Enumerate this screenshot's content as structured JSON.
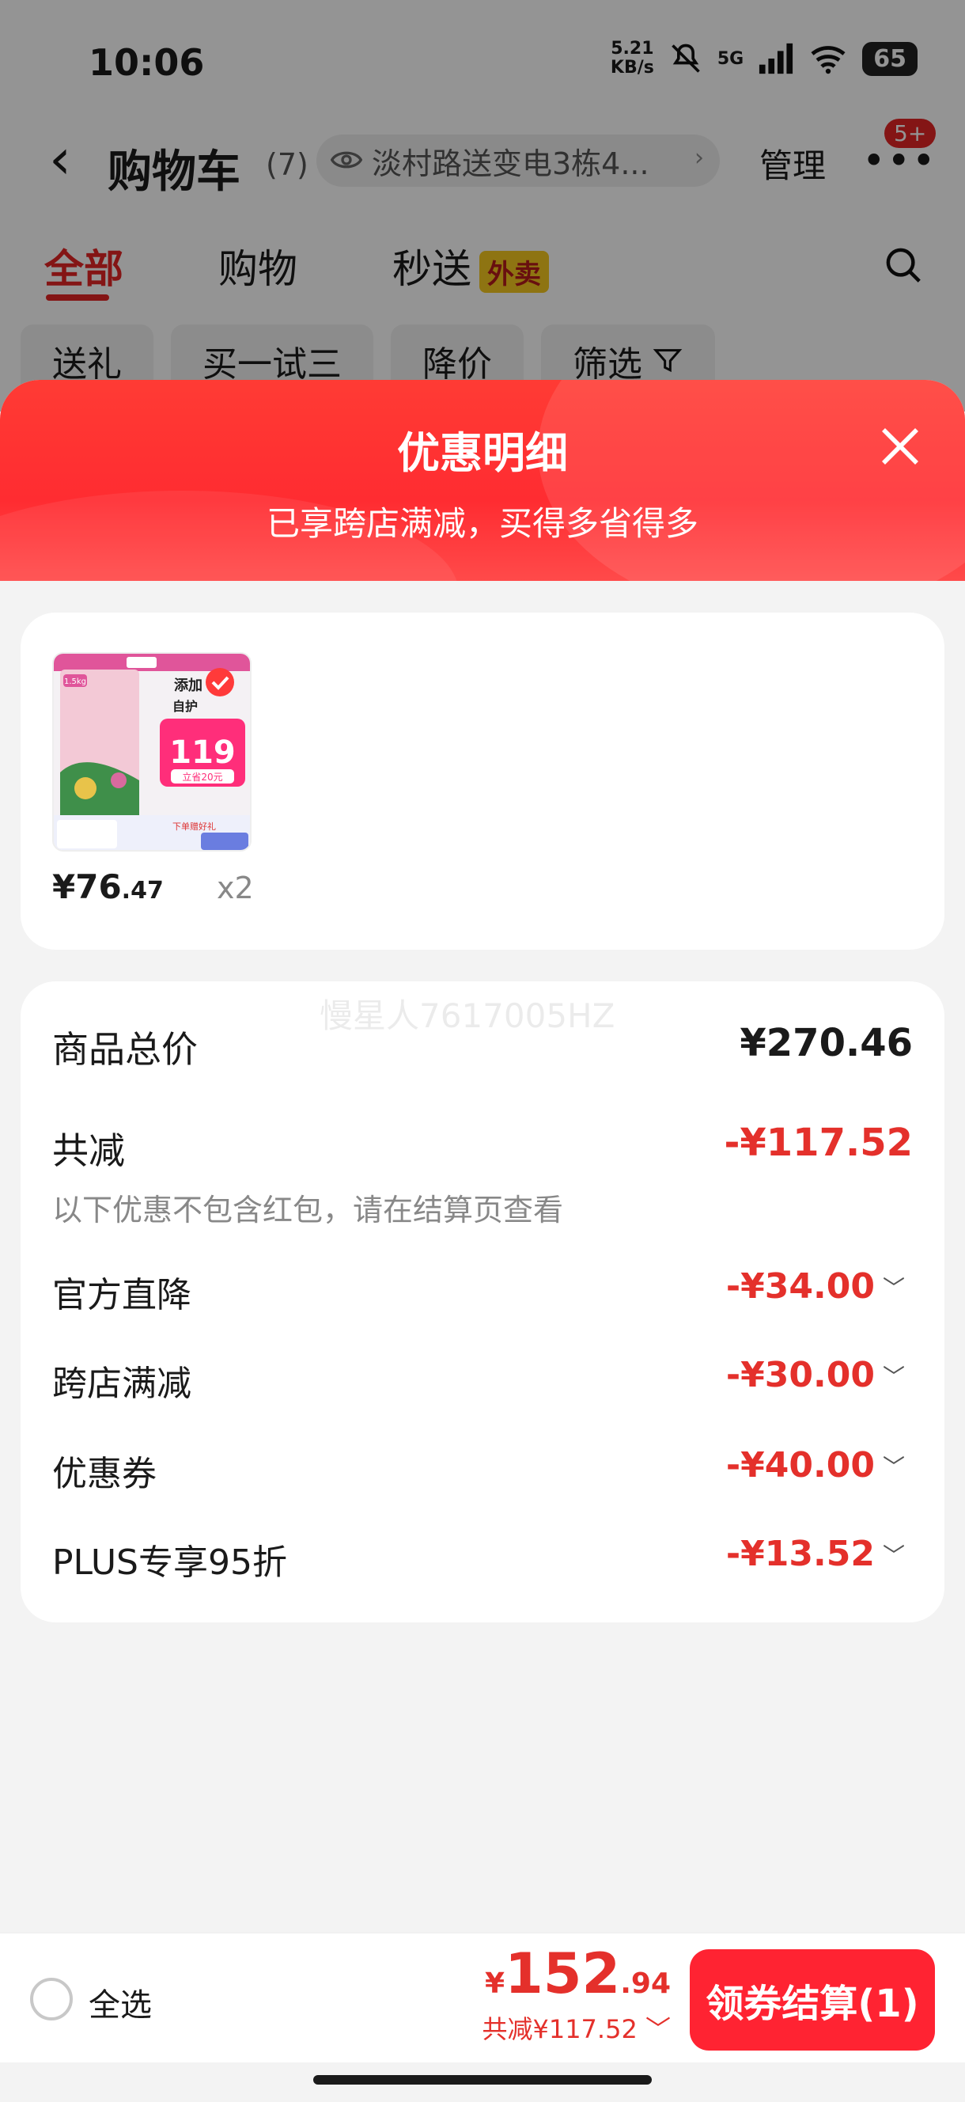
{
  "status_bar": {
    "time": "10:06",
    "net_speed_value": "5.21",
    "net_speed_unit": "KB/s",
    "network": "5G",
    "battery": "65"
  },
  "nav": {
    "title": "购物车",
    "count": "(7)",
    "address": "淡村路送变电3栋4...",
    "manage": "管理",
    "message_badge": "5+"
  },
  "tabs": [
    {
      "label": "全部",
      "active": true
    },
    {
      "label": "购物",
      "active": false
    },
    {
      "label": "秒送",
      "active": false,
      "badge": "外卖"
    }
  ],
  "chips": [
    "送礼",
    "买一试三",
    "降价",
    "筛选"
  ],
  "sheet": {
    "title": "优惠明细",
    "subtitle": "已享跨店满减，买得多省得多"
  },
  "product": {
    "price_int": "¥76",
    "price_dec": ".47",
    "quantity": "x2",
    "thumb_text": {
      "weight": "1.5kg",
      "promo_line1": "添加",
      "promo_line2": "自护",
      "price_box": "119",
      "coupon": "立省20元",
      "bottom": "下单赠好礼"
    }
  },
  "summary": {
    "watermark": "慢星人7617005HZ",
    "total_label": "商品总价",
    "total_value": "¥270.46",
    "reduce_label": "共减",
    "reduce_value": "-¥117.52",
    "note": "以下优惠不包含红包，请在结算页查看"
  },
  "discounts": [
    {
      "label": "官方直降",
      "value": "-¥34.00"
    },
    {
      "label": "跨店满减",
      "value": "-¥30.00"
    },
    {
      "label": "优惠券",
      "value": "-¥40.00"
    },
    {
      "label": "PLUS专享95折",
      "value": "-¥13.52"
    }
  ],
  "bottom_bar": {
    "select_all": "全选",
    "amount_yen": "¥",
    "amount_int": "152",
    "amount_dec": ".94",
    "discount_text": "共减¥117.52",
    "checkout": "领券结算(1)"
  },
  "colors": {
    "accent": "#e4302b",
    "checkout": "#ff2332",
    "header": "#ff3b34"
  }
}
